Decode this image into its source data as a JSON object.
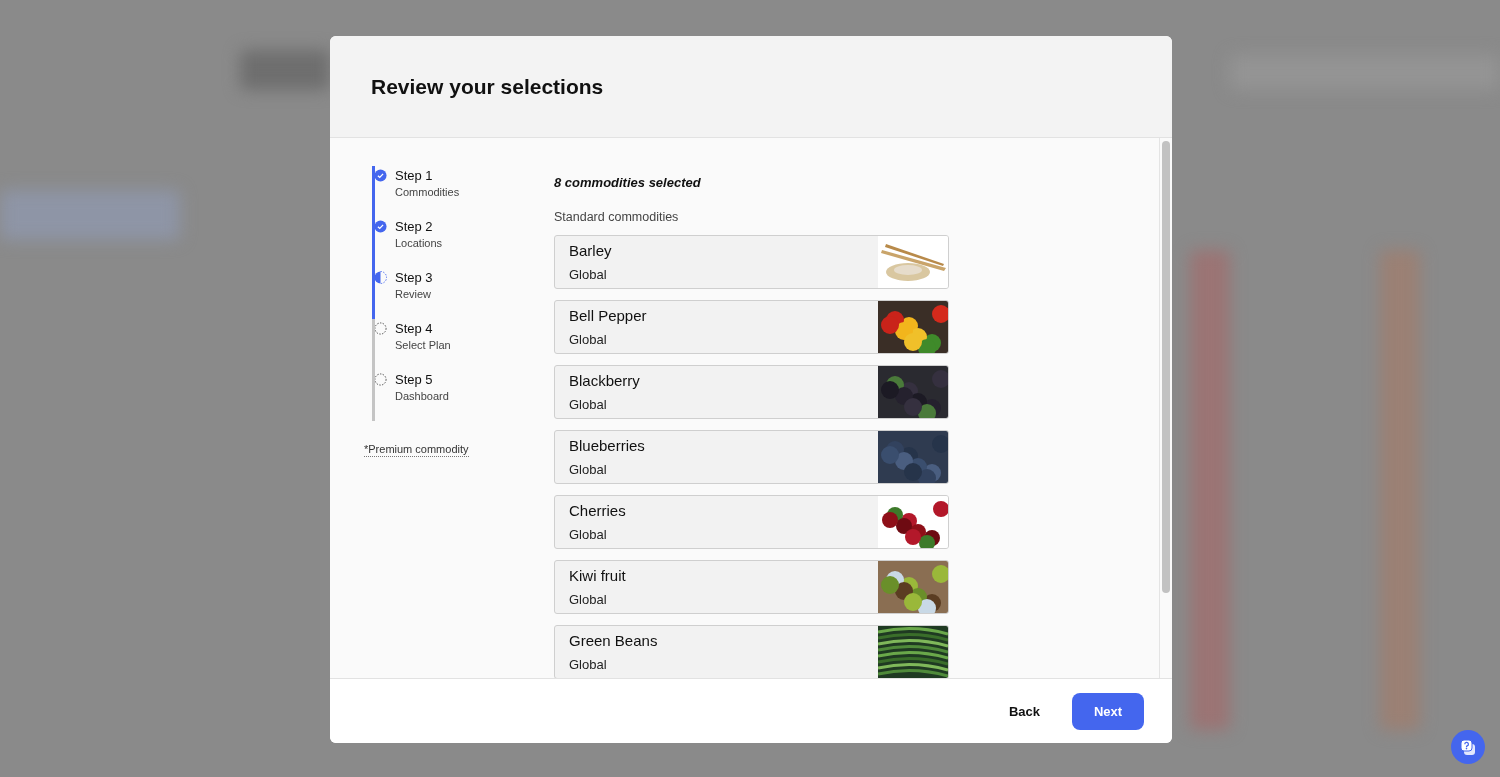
{
  "dialog": {
    "title": "Review your selections"
  },
  "steps": [
    {
      "label": "Step 1",
      "sublabel": "Commodities",
      "completed": true,
      "current": false
    },
    {
      "label": "Step 2",
      "sublabel": "Locations",
      "completed": true,
      "current": false
    },
    {
      "label": "Step 3",
      "sublabel": "Review",
      "completed": false,
      "current": true
    },
    {
      "label": "Step 4",
      "sublabel": "Select Plan",
      "completed": false,
      "current": false
    },
    {
      "label": "Step 5",
      "sublabel": "Dashboard",
      "completed": false,
      "current": false
    }
  ],
  "premium_note": "*Premium commodity",
  "summary": "8 commodities selected",
  "section_label": "Standard commodities",
  "commodities": [
    {
      "name": "Barley",
      "region": "Global"
    },
    {
      "name": "Bell Pepper",
      "region": "Global"
    },
    {
      "name": "Blackberry",
      "region": "Global"
    },
    {
      "name": "Blueberries",
      "region": "Global"
    },
    {
      "name": "Cherries",
      "region": "Global"
    },
    {
      "name": "Kiwi fruit",
      "region": "Global"
    },
    {
      "name": "Green Beans",
      "region": "Global"
    }
  ],
  "buttons": {
    "back": "Back",
    "next": "Next"
  }
}
